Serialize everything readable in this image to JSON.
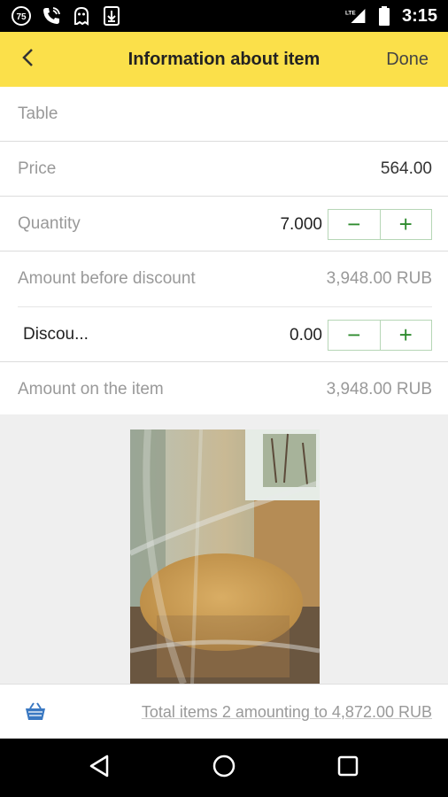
{
  "status_bar": {
    "time": "3:15",
    "network": "LTE",
    "icons": [
      "notification-75-icon",
      "phone-call-icon",
      "ghost-icon",
      "download-icon",
      "signal-icon",
      "battery-icon"
    ]
  },
  "header": {
    "title": "Information about item",
    "done_label": "Done",
    "back_icon": "chevron-left-icon",
    "background": "#fbe04a"
  },
  "form": {
    "table_label": "Table",
    "price_label": "Price",
    "price_value": "564.00",
    "quantity_label": "Quantity",
    "quantity_value": "7.000",
    "amount_before_label": "Amount before discount",
    "amount_before_value": "3,948.00 RUB",
    "discount_label": "Discou...",
    "discount_value": "0.00",
    "amount_item_label": "Amount on the item",
    "amount_item_value": "3,948.00 RUB",
    "stepper_minus": "−",
    "stepper_plus": "+",
    "stepper_color": "#2e8b2e"
  },
  "footer": {
    "total_text": "Total items 2 amounting to 4,872.00 RUB",
    "basket_icon": "basket-icon"
  },
  "nav": {
    "icons": [
      "back-triangle-icon",
      "home-circle-icon",
      "recents-square-icon"
    ]
  }
}
